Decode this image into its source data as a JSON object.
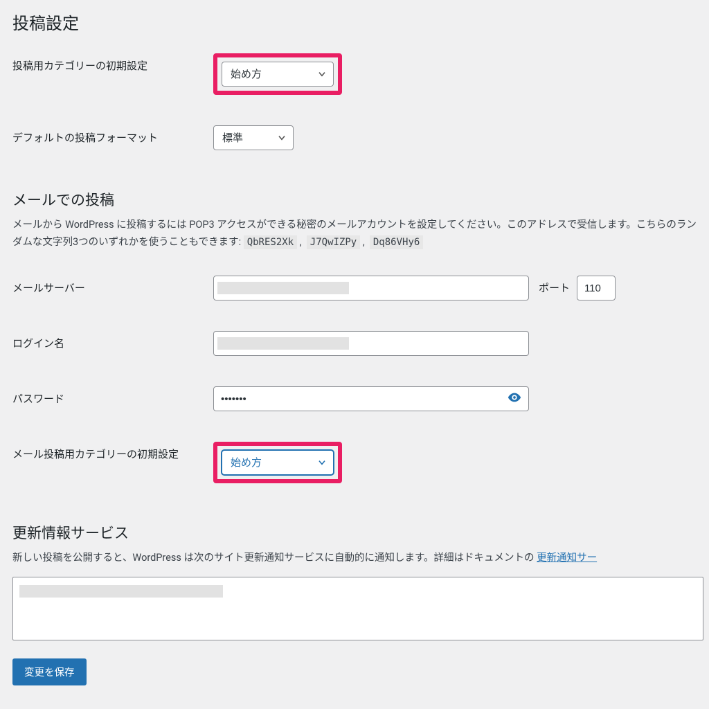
{
  "page": {
    "title": "投稿設定"
  },
  "form1": {
    "default_category": {
      "label": "投稿用カテゴリーの初期設定",
      "value": "始め方"
    },
    "default_format": {
      "label": "デフォルトの投稿フォーマット",
      "value": "標準"
    }
  },
  "mail": {
    "heading": "メールでの投稿",
    "desc_pre": "メールから WordPress に投稿するには POP3 アクセスができる秘密のメールアカウントを設定してください。このアドレスで受信します。こちらのランダムな文字列3つのいずれかを使うこともできます: ",
    "rand": [
      "QbRES2Xk",
      "J7QwIZPy",
      "Dq86VHy6"
    ],
    "server": {
      "label": "メールサーバー",
      "value": "",
      "port_label": "ポート",
      "port_value": "110"
    },
    "login": {
      "label": "ログイン名",
      "value": ""
    },
    "password": {
      "label": "パスワード",
      "value": "•••••••"
    },
    "mail_category": {
      "label": "メール投稿用カテゴリーの初期設定",
      "value": "始め方"
    }
  },
  "services": {
    "heading": "更新情報サービス",
    "desc_pre": "新しい投稿を公開すると、WordPress は次のサイト更新通知サービスに自動的に通知します。詳細はドキュメントの ",
    "doc_link_text": "更新通知サー",
    "value": ""
  },
  "save_button": "変更を保存"
}
